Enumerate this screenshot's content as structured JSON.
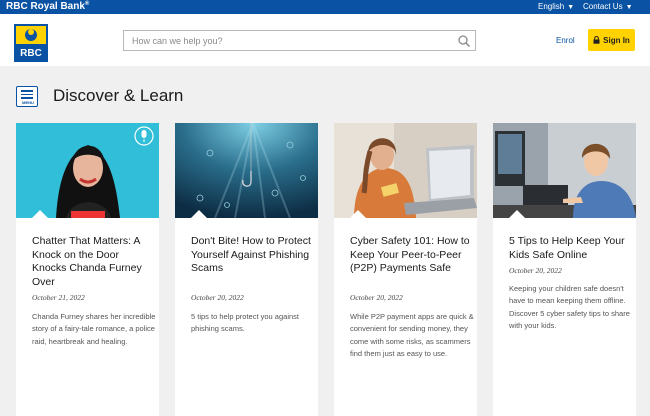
{
  "topbar": {
    "brand": "RBC Royal Bank",
    "brand_mark": "®",
    "language": "English",
    "contact": "Contact Us"
  },
  "header": {
    "logo_text": "RBC",
    "search_placeholder": "How can we help you?",
    "enrol_label": "Enrol",
    "signin_label": "Sign In"
  },
  "page": {
    "menu_label": "MENU",
    "title": "Discover & Learn"
  },
  "colors": {
    "brand_blue": "#0a52a3",
    "signin_yellow": "#ffd200"
  },
  "cards": [
    {
      "title": "Chatter That Matters: A Knock on the Door Knocks Chanda Furney Over",
      "date": "October 21, 2022",
      "description": "Chanda Furney shares her incredible story of a fairy-tale romance, a police raid, heartbreak and healing.",
      "image": "woman-portrait-podcast-image"
    },
    {
      "title": "Don't Bite! How to Protect Yourself Against Phishing Scams",
      "date": "October 20, 2022",
      "description": "5 tips to help protect you against phishing scams.",
      "image": "underwater-fishing-hook-image"
    },
    {
      "title": "Cyber Safety 101: How to Keep Your Peer-to-Peer (P2P) Payments Safe",
      "date": "October 20, 2022",
      "description": "While P2P payment apps are quick & convenient for sending money, they come with some risks, as scammers find them just as easy to use.",
      "image": "woman-laptop-credit-card-image"
    },
    {
      "title": "5 Tips to Help Keep Your Kids Safe Online",
      "date": "October 20, 2022",
      "description": "Keeping your children safe doesn't have to mean keeping them offline. Discover 5 cyber safety tips to share with your kids.",
      "image": "boy-at-computer-image"
    }
  ]
}
